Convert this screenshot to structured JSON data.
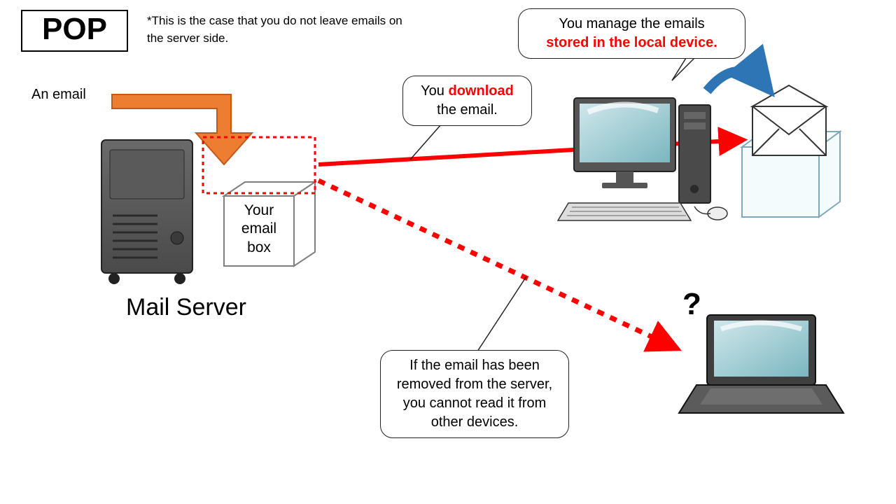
{
  "title": "POP",
  "footnote": "*This is the case that you do not leave emails on the server side.",
  "email_label": "An email",
  "mailbox_label_l1": "Your",
  "mailbox_label_l2": "email",
  "mailbox_label_l3": "box",
  "mail_server_heading": "Mail Server",
  "callout_download_pre": "You ",
  "callout_download_red": "download",
  "callout_download_post": " the email.",
  "callout_manage_pre": "You manage the emails",
  "callout_manage_red": "stored in the local device.",
  "callout_removed": "If the email has been removed from the server, you cannot read it from other devices.",
  "question_mark": "?",
  "colors": {
    "red": "#ff0000",
    "orange": "#ed7d31",
    "blue": "#2e75b6"
  }
}
